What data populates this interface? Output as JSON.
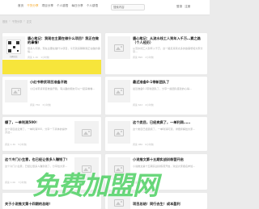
{
  "header": {
    "nav": [
      {
        "label": "首页",
        "active": false
      },
      {
        "label": "干货分享",
        "active": true
      },
      {
        "label": "项目分享",
        "active": false
      },
      {
        "label": "个人感悟",
        "active": false
      },
      {
        "label": "每日分享",
        "active": false
      },
      {
        "label": "个人感悟",
        "active": false
      }
    ],
    "search_placeholder": "搜索内容",
    "login_label": "登录",
    "register_label": "注册"
  },
  "breadcrumb": [
    "首页",
    "干货分享",
    "正文"
  ],
  "cards": [
    {
      "title": "唐心笔记：我现在主要在做什么项目？我正在做的事情！",
      "desc": "很多人问我，现在主要在做什么项目，今天就来聊聊我正在做的事情...",
      "views": "阅读 1.1K",
      "time": "1小时前"
    },
    {
      "title": "唐心笔记：从流水线工人到年入千万…素之路（个人经历）",
      "desc": "从流水线工人到年入千万，这一路走来有太多的故事想和大家分享...",
      "views": "阅读 890",
      "time": "2小时前"
    },
    {
      "title": "小红书带货项目准备开跑",
      "desc": "小红书带货项目准备开跑，有兴趣的朋友可以一起来看看...",
      "views": "阅读 756",
      "time": "3小时前"
    },
    {
      "title": "最近准备0-1带新团队了",
      "desc": "最近准备0-1带新团队了，分享一些团队搭建的心得...",
      "views": "阅读 642",
      "time": "4小时前"
    },
    {
      "title": "爆了，一单利润500！",
      "desc": "这个项目最近爆了，一单利润500，分享一下具体的操作方法...",
      "views": "阅读 1.3K",
      "time": "5小时前"
    },
    {
      "title": "这个类目，已经卖疯了，一单利润……",
      "desc": "这个类目已经卖疯了，一单利润可观，详细拆解给大家...",
      "views": "阅读 980",
      "time": "6小时前"
    },
    {
      "title": "这个冷门小生意，也已经让很多人赚钱了！",
      "desc": "这个冷门小生意，已经让很多人赚到钱了，分享给大家...",
      "views": "阅读 1.0K",
      "time": "7小时前"
    },
    {
      "title": "小说推文第十五期实战训练营开启",
      "desc": "小说推文第十五期实战训练营开启，欢迎大家报名参加...",
      "views": "阅读 720",
      "time": "8小时前"
    },
    {
      "title": "关于小说推文第十四期的总结！",
      "desc": "",
      "views": "",
      "time": ""
    },
    {
      "title": "项目总结！同行去生！成本盈利",
      "desc": "",
      "views": "",
      "time": ""
    }
  ],
  "qr_caption": "扫码关注",
  "watermark": "免费加盟网",
  "colors": {
    "accent": "#f5a623",
    "yellow_band": "#f7e53b",
    "watermark": "#2ec846"
  }
}
